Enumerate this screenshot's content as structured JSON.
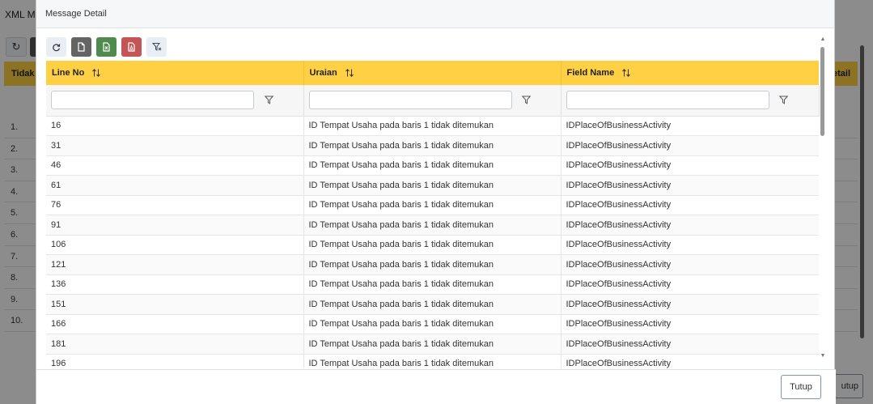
{
  "background": {
    "title": "XML Mo",
    "refresh_icon": "refresh-icon",
    "header_left": "Tidak",
    "header_right": "etail",
    "row_numbers": [
      "1.",
      "2.",
      "3.",
      "4.",
      "5.",
      "6.",
      "7.",
      "8.",
      "9.",
      "10."
    ],
    "footer_button": "utup"
  },
  "modal": {
    "title": "Message Detail",
    "toolbar": {
      "icons": [
        "refresh-icon",
        "file-icon",
        "excel-icon",
        "pdf-icon",
        "clear-filter-icon"
      ]
    },
    "columns": [
      {
        "label": "Line No"
      },
      {
        "label": "Uraian"
      },
      {
        "label": "Field Name"
      }
    ],
    "filters": [
      {
        "value": "",
        "placeholder": ""
      },
      {
        "value": "",
        "placeholder": ""
      },
      {
        "value": "",
        "placeholder": ""
      }
    ],
    "rows": [
      {
        "line_no": "16",
        "uraian": "ID Tempat Usaha pada baris 1 tidak ditemukan",
        "field_name": "IDPlaceOfBusinessActivity"
      },
      {
        "line_no": "31",
        "uraian": "ID Tempat Usaha pada baris 1 tidak ditemukan",
        "field_name": "IDPlaceOfBusinessActivity"
      },
      {
        "line_no": "46",
        "uraian": "ID Tempat Usaha pada baris 1 tidak ditemukan",
        "field_name": "IDPlaceOfBusinessActivity"
      },
      {
        "line_no": "61",
        "uraian": "ID Tempat Usaha pada baris 1 tidak ditemukan",
        "field_name": "IDPlaceOfBusinessActivity"
      },
      {
        "line_no": "76",
        "uraian": "ID Tempat Usaha pada baris 1 tidak ditemukan",
        "field_name": "IDPlaceOfBusinessActivity"
      },
      {
        "line_no": "91",
        "uraian": "ID Tempat Usaha pada baris 1 tidak ditemukan",
        "field_name": "IDPlaceOfBusinessActivity"
      },
      {
        "line_no": "106",
        "uraian": "ID Tempat Usaha pada baris 1 tidak ditemukan",
        "field_name": "IDPlaceOfBusinessActivity"
      },
      {
        "line_no": "121",
        "uraian": "ID Tempat Usaha pada baris 1 tidak ditemukan",
        "field_name": "IDPlaceOfBusinessActivity"
      },
      {
        "line_no": "136",
        "uraian": "ID Tempat Usaha pada baris 1 tidak ditemukan",
        "field_name": "IDPlaceOfBusinessActivity"
      },
      {
        "line_no": "151",
        "uraian": "ID Tempat Usaha pada baris 1 tidak ditemukan",
        "field_name": "IDPlaceOfBusinessActivity"
      },
      {
        "line_no": "166",
        "uraian": "ID Tempat Usaha pada baris 1 tidak ditemukan",
        "field_name": "IDPlaceOfBusinessActivity"
      },
      {
        "line_no": "181",
        "uraian": "ID Tempat Usaha pada baris 1 tidak ditemukan",
        "field_name": "IDPlaceOfBusinessActivity"
      },
      {
        "line_no": "196",
        "uraian": "ID Tempat Usaha pada baris 1 tidak ditemukan",
        "field_name": "IDPlaceOfBusinessActivity"
      }
    ],
    "footer": {
      "close_label": "Tutup"
    }
  },
  "colors": {
    "header_yellow": "#ffd043",
    "excel_green": "#4f8a4f",
    "pdf_red": "#c45557",
    "doc_gray": "#646464"
  }
}
